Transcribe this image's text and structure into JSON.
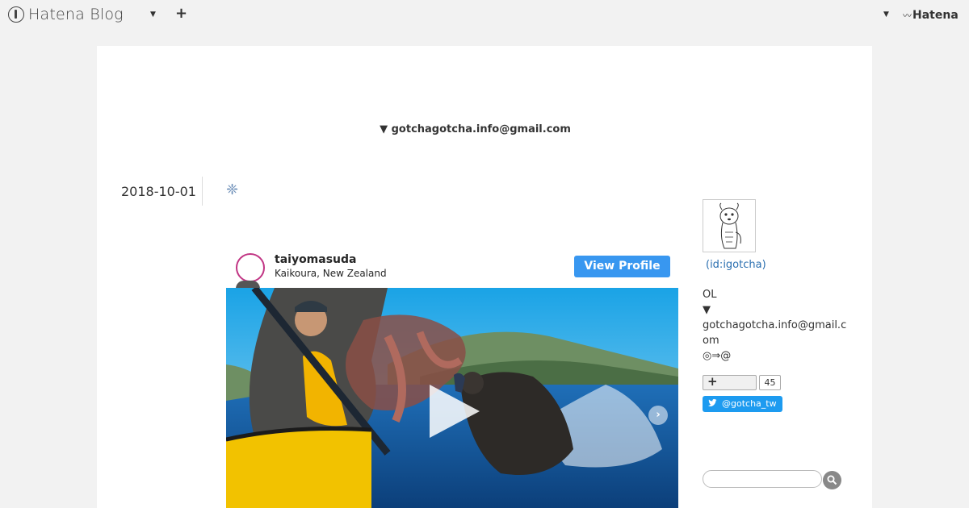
{
  "topbar": {
    "brand": "Hatena Blog",
    "add_label": "+",
    "right_brand": "Hatena",
    "right_wave": "〰"
  },
  "blog": {
    "header_email": "▼ gotchagotcha.info@gmail.com"
  },
  "entry": {
    "date": "2018-10-01"
  },
  "instagram": {
    "username": "taiyomasuda",
    "location": "Kaikoura, New Zealand",
    "view_profile": "View Profile",
    "next_glyph": "›"
  },
  "sidebar": {
    "profile_id": "(id:igotcha)",
    "bio": [
      "OL",
      "▼",
      "gotchagotcha.info@gmail.com",
      "◎⇒@"
    ],
    "bookmark_plus": "+",
    "bookmark_count": "45",
    "twitter": "@gotcha_tw"
  },
  "colors": {
    "accent": "#3897f0",
    "link": "#2a6fb0",
    "twitter": "#1d9bf0",
    "page_bg": "#f2f2f2"
  }
}
